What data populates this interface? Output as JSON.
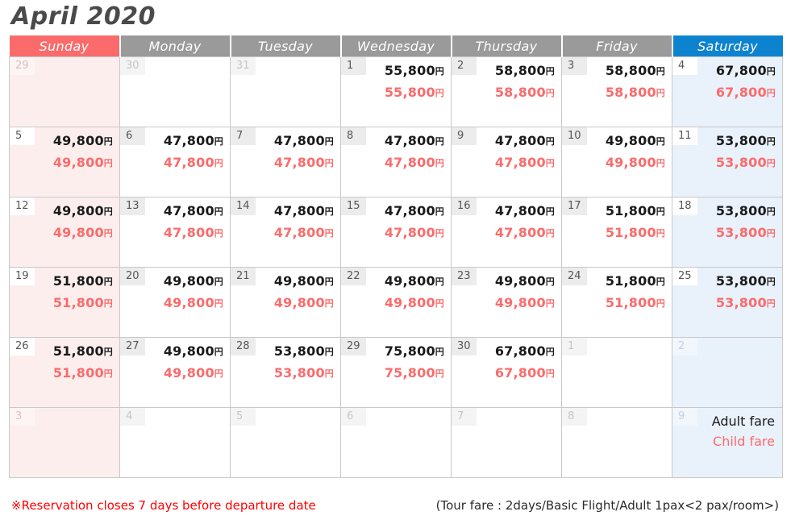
{
  "title": "April 2020",
  "weekdays": [
    {
      "label": "Sunday",
      "kind": "sun"
    },
    {
      "label": "Monday",
      "kind": "wd"
    },
    {
      "label": "Tuesday",
      "kind": "wd"
    },
    {
      "label": "Wednesday",
      "kind": "wd"
    },
    {
      "label": "Thursday",
      "kind": "wd"
    },
    {
      "label": "Friday",
      "kind": "wd"
    },
    {
      "label": "Saturday",
      "kind": "sat"
    }
  ],
  "currency_symbol": "円",
  "colors": {
    "sunday_header": "#fb6b6b",
    "saturday_header": "#0d83d0",
    "weekday_header": "#9a9a9a",
    "sunday_cell": "#fdeeee",
    "saturday_cell": "#e9f1fb",
    "adult_price": "#1a1a1a",
    "child_price": "#fb6b6b",
    "notice": "#ff0000",
    "daynum_badge": "#ececec"
  },
  "legend": {
    "adult_label": "Adult fare",
    "child_label": "Child fare"
  },
  "footer": {
    "notice": "※Reservation closes 7 days before departure date",
    "fare_note": "(Tour fare : 2days/Basic Flight/Adult 1pax<2 pax/room>)"
  },
  "weeks": [
    [
      {
        "day": "29",
        "in_month": false,
        "adult": "",
        "child": ""
      },
      {
        "day": "30",
        "in_month": false,
        "adult": "",
        "child": ""
      },
      {
        "day": "31",
        "in_month": false,
        "adult": "",
        "child": ""
      },
      {
        "day": "1",
        "in_month": true,
        "adult": "55,800",
        "child": "55,800"
      },
      {
        "day": "2",
        "in_month": true,
        "adult": "58,800",
        "child": "58,800"
      },
      {
        "day": "3",
        "in_month": true,
        "adult": "58,800",
        "child": "58,800"
      },
      {
        "day": "4",
        "in_month": true,
        "adult": "67,800",
        "child": "67,800"
      }
    ],
    [
      {
        "day": "5",
        "in_month": true,
        "adult": "49,800",
        "child": "49,800"
      },
      {
        "day": "6",
        "in_month": true,
        "adult": "47,800",
        "child": "47,800"
      },
      {
        "day": "7",
        "in_month": true,
        "adult": "47,800",
        "child": "47,800"
      },
      {
        "day": "8",
        "in_month": true,
        "adult": "47,800",
        "child": "47,800"
      },
      {
        "day": "9",
        "in_month": true,
        "adult": "47,800",
        "child": "47,800"
      },
      {
        "day": "10",
        "in_month": true,
        "adult": "49,800",
        "child": "49,800"
      },
      {
        "day": "11",
        "in_month": true,
        "adult": "53,800",
        "child": "53,800"
      }
    ],
    [
      {
        "day": "12",
        "in_month": true,
        "adult": "49,800",
        "child": "49,800"
      },
      {
        "day": "13",
        "in_month": true,
        "adult": "47,800",
        "child": "47,800"
      },
      {
        "day": "14",
        "in_month": true,
        "adult": "47,800",
        "child": "47,800"
      },
      {
        "day": "15",
        "in_month": true,
        "adult": "47,800",
        "child": "47,800"
      },
      {
        "day": "16",
        "in_month": true,
        "adult": "47,800",
        "child": "47,800"
      },
      {
        "day": "17",
        "in_month": true,
        "adult": "51,800",
        "child": "51,800"
      },
      {
        "day": "18",
        "in_month": true,
        "adult": "53,800",
        "child": "53,800"
      }
    ],
    [
      {
        "day": "19",
        "in_month": true,
        "adult": "51,800",
        "child": "51,800"
      },
      {
        "day": "20",
        "in_month": true,
        "adult": "49,800",
        "child": "49,800"
      },
      {
        "day": "21",
        "in_month": true,
        "adult": "49,800",
        "child": "49,800"
      },
      {
        "day": "22",
        "in_month": true,
        "adult": "49,800",
        "child": "49,800"
      },
      {
        "day": "23",
        "in_month": true,
        "adult": "49,800",
        "child": "49,800"
      },
      {
        "day": "24",
        "in_month": true,
        "adult": "51,800",
        "child": "51,800"
      },
      {
        "day": "25",
        "in_month": true,
        "adult": "53,800",
        "child": "53,800"
      }
    ],
    [
      {
        "day": "26",
        "in_month": true,
        "adult": "51,800",
        "child": "51,800"
      },
      {
        "day": "27",
        "in_month": true,
        "adult": "49,800",
        "child": "49,800"
      },
      {
        "day": "28",
        "in_month": true,
        "adult": "53,800",
        "child": "53,800"
      },
      {
        "day": "29",
        "in_month": true,
        "adult": "75,800",
        "child": "75,800"
      },
      {
        "day": "30",
        "in_month": true,
        "adult": "67,800",
        "child": "67,800"
      },
      {
        "day": "1",
        "in_month": false,
        "adult": "",
        "child": ""
      },
      {
        "day": "2",
        "in_month": false,
        "adult": "",
        "child": ""
      }
    ],
    [
      {
        "day": "3",
        "in_month": false,
        "adult": "",
        "child": ""
      },
      {
        "day": "4",
        "in_month": false,
        "adult": "",
        "child": ""
      },
      {
        "day": "5",
        "in_month": false,
        "adult": "",
        "child": ""
      },
      {
        "day": "6",
        "in_month": false,
        "adult": "",
        "child": ""
      },
      {
        "day": "7",
        "in_month": false,
        "adult": "",
        "child": ""
      },
      {
        "day": "8",
        "in_month": false,
        "adult": "",
        "child": ""
      },
      {
        "day": "9",
        "in_month": false,
        "adult": "",
        "child": "",
        "legend": true
      }
    ]
  ]
}
